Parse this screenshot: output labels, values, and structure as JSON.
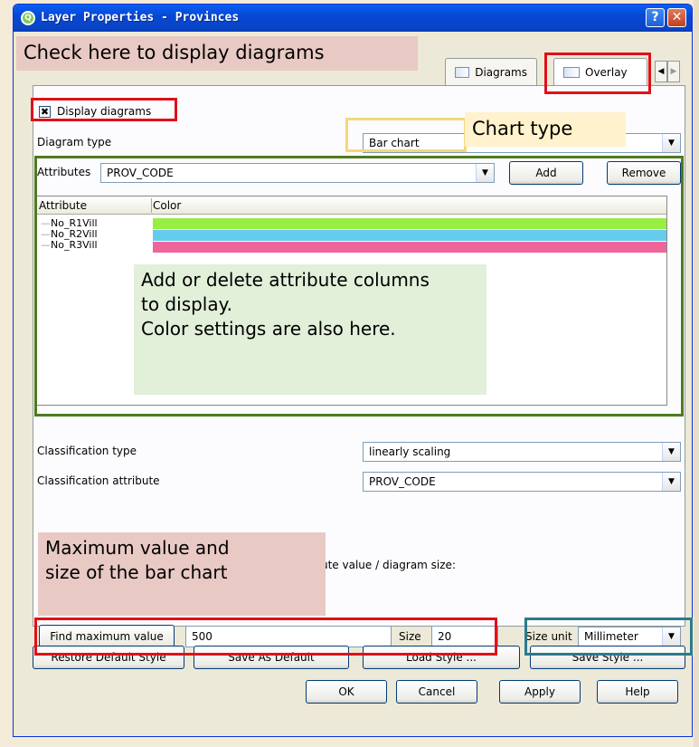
{
  "window": {
    "title": "Layer Properties - Provinces",
    "help_label": "?",
    "close_label": "✕"
  },
  "tabs": {
    "diagrams": "Diagrams",
    "overlay": "Overlay",
    "prev_arrow": "◀",
    "next_arrow": "▶"
  },
  "diagrams": {
    "display_label": "Display diagrams",
    "display_checked_mark": "✖",
    "diagram_type_label": "Diagram type",
    "diagram_type_value": "Bar chart",
    "attributes_label": "Attributes",
    "attributes_value": "PROV_CODE",
    "add_label": "Add",
    "remove_label": "Remove",
    "table": {
      "headers": [
        "Attribute",
        "Color"
      ],
      "rows": [
        {
          "name": "No_R1Vill",
          "color": "#99ee44"
        },
        {
          "name": "No_R2Vill",
          "color": "#66ccee"
        },
        {
          "name": "No_R3Vill",
          "color": "#ee6699"
        }
      ]
    },
    "classification_type_label": "Classification type",
    "classification_type_value": "linearly scaling",
    "classification_attribute_label": "Classification attribute",
    "classification_attribute_value": "PROV_CODE",
    "size_relation_label_visible": "ute value / diagram size:",
    "find_max_label": "Find maximum value",
    "max_value": "500",
    "size_label": "Size",
    "size_value": "20",
    "size_unit_label": "Size unit",
    "size_unit_value": "Millimeter"
  },
  "bottom_buttons": {
    "restore": "Restore Default Style",
    "save_default": "Save As Default",
    "load_style": "Load Style ...",
    "save_style": "Save Style ...",
    "ok": "OK",
    "cancel": "Cancel",
    "apply": "Apply",
    "help": "Help"
  },
  "annotations": {
    "check_here": "Check here to display diagrams",
    "chart_type": "Chart type",
    "add_delete_line1": "Add or delete attribute columns",
    "add_delete_line2": "to display.",
    "add_delete_line3": "Color settings are also here.",
    "max_value_line1": "Maximum value and",
    "max_value_line2": "size of the bar chart"
  },
  "colors": {
    "title_bar": "#0649d6",
    "annotation_red": "#e0101a",
    "annotation_pink_bg": "#e8c9c4",
    "annotation_green_bg": "#e2efd9"
  }
}
